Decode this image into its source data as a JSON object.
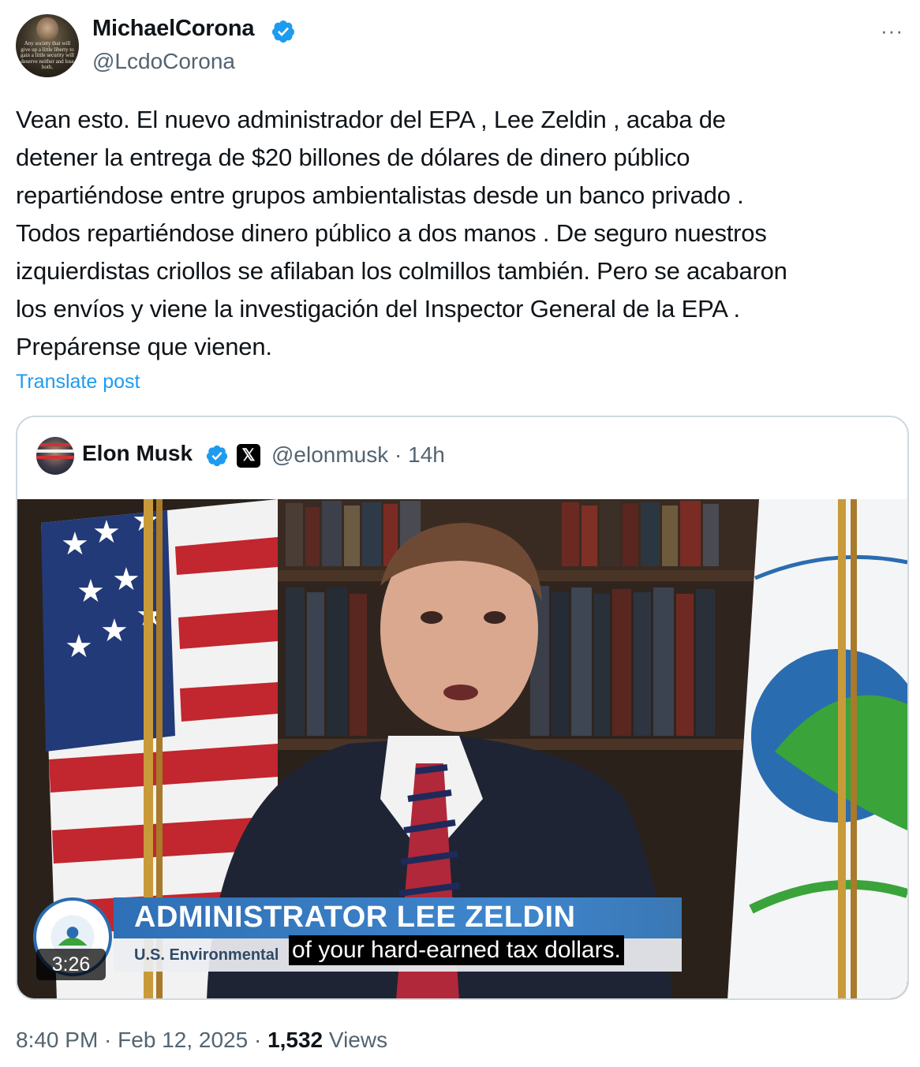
{
  "author": {
    "name": "MichaelCorona",
    "handle": "@LcdoCorona",
    "avatar_quote": "Any society that will give up a little liberty to gain a little security will deserve neither and lose both."
  },
  "tweet": {
    "lines": [
      "Vean esto. El nuevo administrador del EPA , Lee Zeldin , acaba de",
      "detener la entrega de $20 billones de dólares de dinero público",
      "repartiéndose entre grupos ambientalistas desde un banco privado .",
      "Todos repartiéndose dinero público a dos manos . De seguro nuestros",
      "izquierdistas criollos se afilaban los colmillos también. Pero se acabaron",
      "los envíos y viene la investigación del Inspector General de la EPA .",
      "Prepárense que vienen."
    ],
    "translate_label": "Translate post"
  },
  "quoted": {
    "name": "Elon Musk",
    "handle_time": "@elonmusk · 14h",
    "video": {
      "duration": "3:26",
      "lower_third_title": "ADMINISTRATOR LEE ZELDIN",
      "lower_third_sub": "U.S. Environmental",
      "caption": "of your hard-earned tax dollars."
    }
  },
  "meta": {
    "time_date": "8:40 PM · Feb 12, 2025 · ",
    "views_count": "1,532",
    "views_label": " Views"
  },
  "colors": {
    "accent": "#1d9bf0",
    "secondary_text": "#536471",
    "border": "#cfd9de"
  },
  "icons": [
    "verified-badge-icon",
    "more-icon",
    "x-logo-icon"
  ]
}
